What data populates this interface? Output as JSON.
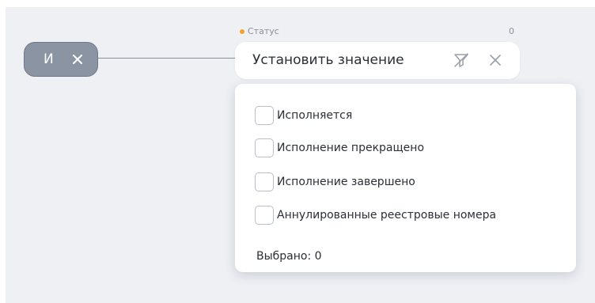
{
  "canvas": {
    "and_node": {
      "label": "И",
      "remove_glyph": "close-icon"
    },
    "condition": {
      "status_dot_color": "#f5a030",
      "field_label": "Статус",
      "count": "0",
      "value": "Установить значение",
      "filter_icon": "filter-clear-icon",
      "clear_icon": "close-icon"
    },
    "dropdown": {
      "options": [
        {
          "label": "Исполняется",
          "checked": false
        },
        {
          "label": "Исполнение прекращено",
          "checked": false
        },
        {
          "label": "Исполнение завершено",
          "checked": false
        },
        {
          "label": "Аннулированные реестровые номера",
          "checked": false
        }
      ],
      "selected_text": "Выбрано: 0"
    }
  },
  "colors": {
    "canvas_bg": "#eef0f4",
    "node_bg": "#8b94a3",
    "accent_dot": "#f5a030"
  }
}
